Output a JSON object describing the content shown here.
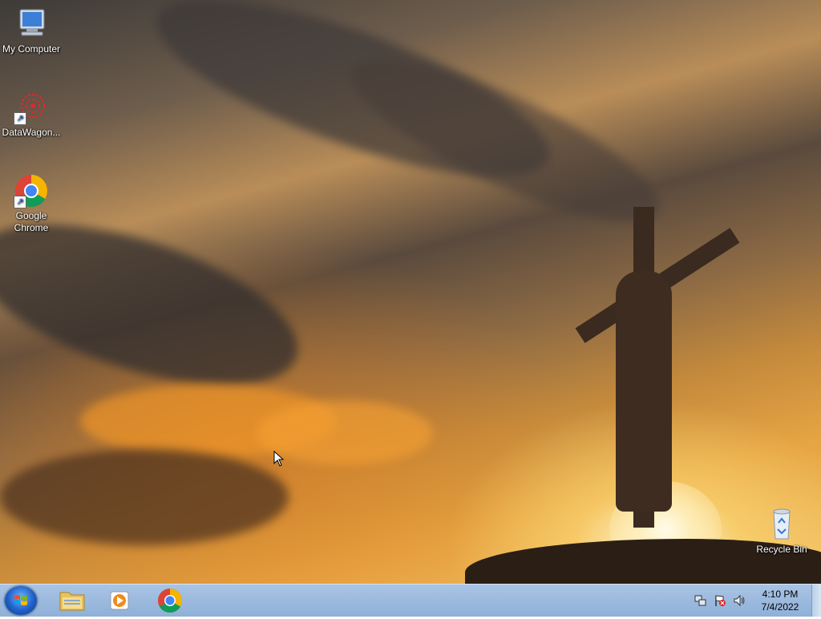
{
  "desktop": {
    "icons": [
      {
        "label": "My Computer",
        "icon": "computer-icon"
      },
      {
        "label": "DataWagon...",
        "icon": "datawagon-icon"
      },
      {
        "label": "Google Chrome",
        "label_line1": "Google",
        "label_line2": "Chrome",
        "icon": "chrome-icon"
      },
      {
        "label": "Recycle Bin",
        "icon": "recycle-bin-icon"
      }
    ]
  },
  "taskbar": {
    "start_icon": "windows-start-icon",
    "pinned": [
      {
        "name": "file-explorer",
        "icon": "folder-icon"
      },
      {
        "name": "media-player",
        "icon": "media-player-icon"
      },
      {
        "name": "google-chrome",
        "icon": "chrome-icon"
      }
    ],
    "tray": {
      "icons": [
        "network-icon",
        "action-center-flag-icon",
        "volume-icon"
      ],
      "time": "4:10 PM",
      "date": "7/4/2022"
    }
  },
  "colors": {
    "taskbar": "#a9c4e4",
    "sunset_orange": "#e6a443"
  }
}
